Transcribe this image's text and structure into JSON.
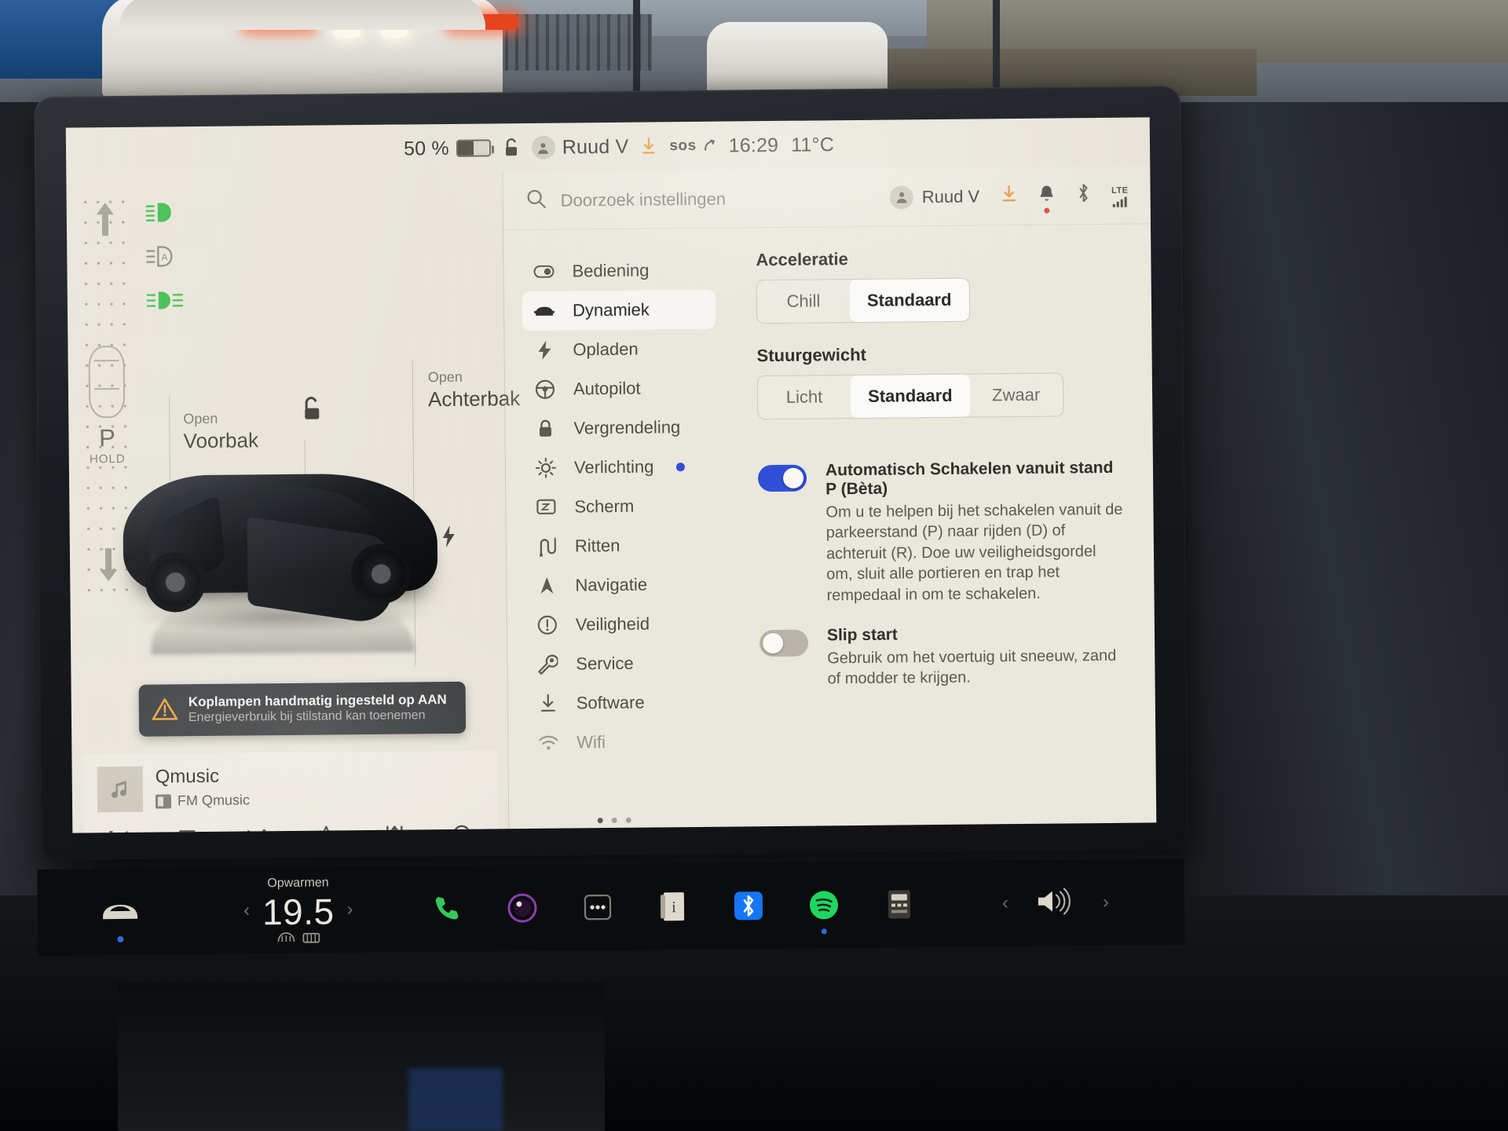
{
  "statusbar": {
    "battery_percent": "50 %",
    "lock_icon": "unlocked-padlock-icon",
    "profile_name": "Ruud V",
    "download_icon": "download-icon",
    "sos_label": "sos",
    "time": "16:29",
    "temperature": "11°C"
  },
  "vehicle": {
    "gear": {
      "letter": "P",
      "hold": "HOLD",
      "up_icon": "arrow-up-icon",
      "down_icon": "arrow-down-icon"
    },
    "telltales": [
      {
        "name": "low-beam-headlight-icon",
        "color": "#39b54a"
      },
      {
        "name": "auto-headlight-icon",
        "color": "#8b8880"
      },
      {
        "name": "fog-light-icon",
        "color": "#39b54a"
      }
    ],
    "frunk": {
      "kicker": "Open",
      "name": "Voorbak"
    },
    "trunk": {
      "kicker": "Open",
      "name": "Achterbak"
    },
    "lock_icon": "unlocked-padlock-icon",
    "charge_icon": "charge-bolt-icon",
    "warning": {
      "icon": "warning-triangle-icon",
      "title": "Koplampen handmatig ingesteld op AAN",
      "subtitle": "Energieverbruik bij stilstand kan toenemen",
      "accent": "#e8a33d"
    }
  },
  "media": {
    "title": "Qmusic",
    "source": "FM Qmusic",
    "art_icon": "music-note-icon",
    "controls": [
      {
        "name": "previous-button",
        "glyph": "prev"
      },
      {
        "name": "stop-button",
        "glyph": "stop"
      },
      {
        "name": "next-button",
        "glyph": "next"
      },
      {
        "name": "favorite-button",
        "glyph": "star"
      },
      {
        "name": "equalizer-button",
        "glyph": "sliders"
      },
      {
        "name": "search-media-button",
        "glyph": "search"
      }
    ]
  },
  "settings": {
    "search": {
      "placeholder": "Doorzoek instellingen",
      "icon": "search-icon"
    },
    "topbar_right": {
      "profile_name": "Ruud V",
      "icons": [
        "download-icon",
        "bell-icon",
        "bluetooth-icon",
        "lte-signal-icon"
      ],
      "lte_label": "LTE"
    },
    "nav": [
      {
        "label": "Bediening",
        "icon": "toggle-switch-icon",
        "active": false,
        "badge": false
      },
      {
        "label": "Dynamiek",
        "icon": "car-front-icon",
        "active": true,
        "badge": false
      },
      {
        "label": "Opladen",
        "icon": "lightning-bolt-icon",
        "active": false,
        "badge": false
      },
      {
        "label": "Autopilot",
        "icon": "steering-wheel-icon",
        "active": false,
        "badge": false
      },
      {
        "label": "Vergrendeling",
        "icon": "lock-icon",
        "active": false,
        "badge": false
      },
      {
        "label": "Verlichting",
        "icon": "sun-brightness-icon",
        "active": false,
        "badge": true
      },
      {
        "label": "Scherm",
        "icon": "display-icon",
        "active": false,
        "badge": false
      },
      {
        "label": "Ritten",
        "icon": "winding-road-icon",
        "active": false,
        "badge": false
      },
      {
        "label": "Navigatie",
        "icon": "navigation-arrow-icon",
        "active": false,
        "badge": false
      },
      {
        "label": "Veiligheid",
        "icon": "exclamation-circle-icon",
        "active": false,
        "badge": false
      },
      {
        "label": "Service",
        "icon": "wrench-icon",
        "active": false,
        "badge": false
      },
      {
        "label": "Software",
        "icon": "download-icon",
        "active": false,
        "badge": false
      },
      {
        "label": "Wifi",
        "icon": "wifi-icon",
        "active": false,
        "badge": false
      }
    ],
    "acceleration": {
      "title": "Acceleratie",
      "options": [
        "Chill",
        "Standaard"
      ],
      "selected": "Standaard"
    },
    "steering": {
      "title": "Stuurgewicht",
      "options": [
        "Licht",
        "Standaard",
        "Zwaar"
      ],
      "selected": "Standaard"
    },
    "toggles": [
      {
        "title": "Automatisch Schakelen vanuit stand P (Bèta)",
        "description": "Om u te helpen bij het schakelen vanuit de parkeerstand (P) naar rijden (D) of achteruit (R). Doe uw veiligheidsgordel om, sluit alle portieren en trap het rempedaal in om te schakelen.",
        "state": "on"
      },
      {
        "title": "Slip start",
        "description": "Gebruik om het voertuig uit sneeuw, zand of modder te krijgen.",
        "state": "off"
      }
    ],
    "accent_color": "#2f4fd8"
  },
  "taskbar": {
    "car_icon": "car-front-icon",
    "climate": {
      "label": "Opwarmen",
      "temperature": "19.5",
      "left_chevron": "‹",
      "right_chevron": "›"
    },
    "apps": [
      {
        "name": "phone-app-icon",
        "color": "#34c759"
      },
      {
        "name": "camera-app-icon",
        "color": "#8a3fb0"
      },
      {
        "name": "more-apps-icon",
        "color": "#dddddd"
      },
      {
        "name": "owners-manual-icon",
        "color": "#d8d4c8"
      },
      {
        "name": "bluetooth-app-icon",
        "color": "#1476f2"
      },
      {
        "name": "spotify-app-icon",
        "color": "#1ed760"
      },
      {
        "name": "calculator-app-icon",
        "color": "#cfcbbf"
      }
    ],
    "volume": {
      "icon": "speaker-volume-icon",
      "left_chevron": "‹",
      "right_chevron": "›"
    }
  }
}
